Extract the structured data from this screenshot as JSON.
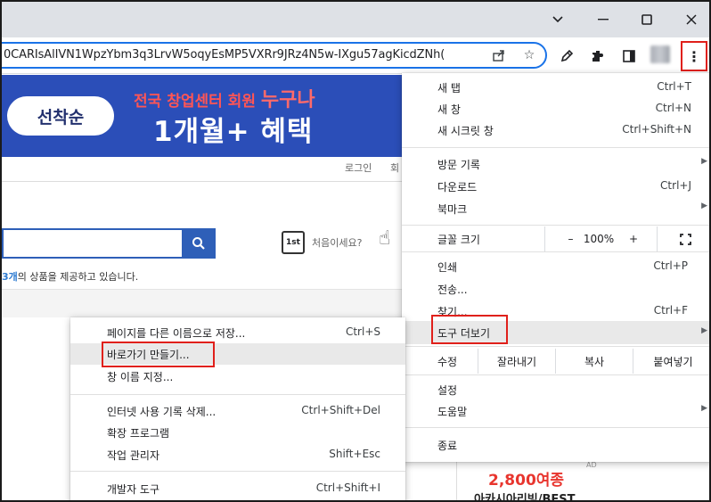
{
  "window": {
    "controls": [
      "chevron-down",
      "minimize",
      "maximize",
      "close"
    ]
  },
  "toolbar": {
    "url": "0CARIsAlIVN1WpzYbm3q3LrvW5oqyEsMP5VXRr9JRz4N5w-IXgu57agKicdZNh(",
    "icons": [
      "share-icon",
      "star-icon",
      "pen-icon",
      "extensions-icon",
      "side-panel-icon",
      "profile-avatar",
      "more-icon"
    ]
  },
  "page": {
    "badge": "선착순",
    "banner_top": "전국 창업센터 회원",
    "banner_highlight": "누구나",
    "banner_main": "1개월+ 혜택",
    "login": "로그인",
    "login2": "회",
    "first_badge": "1st",
    "first_text": "처음이세요?",
    "count_num": "3개",
    "count_rest": "의 상품을 제공하고 있습니다.",
    "ad_label": "AD",
    "ad_price": "2,800여종",
    "ad_sub": "아카시아리빙/BEST"
  },
  "main_menu": {
    "new_tab": {
      "label": "새 탭",
      "accel": "Ctrl+T"
    },
    "new_window": {
      "label": "새 창",
      "accel": "Ctrl+N"
    },
    "incognito": {
      "label": "새 시크릿 창",
      "accel": "Ctrl+Shift+N"
    },
    "history": {
      "label": "방문 기록"
    },
    "downloads": {
      "label": "다운로드",
      "accel": "Ctrl+J"
    },
    "bookmarks": {
      "label": "북마크"
    },
    "zoom": {
      "label": "글꼴 크기",
      "minus": "–",
      "value": "100%",
      "plus": "+"
    },
    "print": {
      "label": "인쇄",
      "accel": "Ctrl+P"
    },
    "cast": {
      "label": "전송..."
    },
    "find": {
      "label": "찾기...",
      "accel": "Ctrl+F"
    },
    "more_tools": {
      "label": "도구 더보기"
    },
    "edit": {
      "label": "수정",
      "cut": "잘라내기",
      "copy": "복사",
      "paste": "붙여넣기"
    },
    "settings": {
      "label": "설정"
    },
    "help": {
      "label": "도움말"
    },
    "exit": {
      "label": "종료"
    }
  },
  "sub_menu": {
    "save_as": {
      "label": "페이지를 다른 이름으로 저장...",
      "accel": "Ctrl+S"
    },
    "create_shortcut": {
      "label": "바로가기 만들기..."
    },
    "name_window": {
      "label": "창 이름 지정..."
    },
    "clear_data": {
      "label": "인터넷 사용 기록 삭제...",
      "accel": "Ctrl+Shift+Del"
    },
    "extensions": {
      "label": "확장 프로그램"
    },
    "task_manager": {
      "label": "작업 관리자",
      "accel": "Shift+Esc"
    },
    "dev_tools": {
      "label": "개발자 도구",
      "accel": "Ctrl+Shift+I"
    }
  },
  "colors": {
    "highlight_box": "#e0201b",
    "accent": "#1a73e8"
  }
}
